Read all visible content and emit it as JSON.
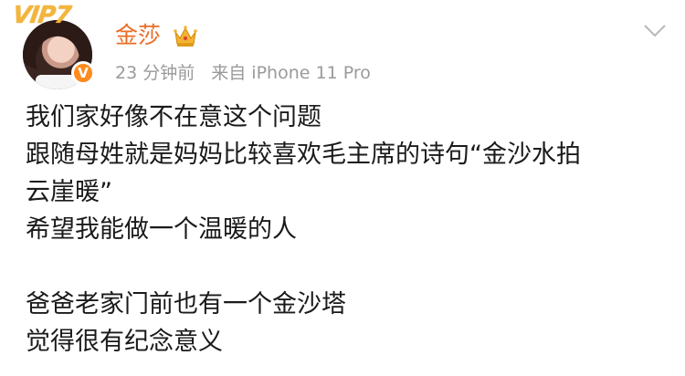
{
  "badge": {
    "vip_text": "VIP7"
  },
  "user": {
    "name": "金莎",
    "verified_symbol": "V"
  },
  "meta": {
    "time": "23 分钟前",
    "source": "来自 iPhone 11 Pro"
  },
  "post": {
    "lines": [
      "我们家好像不在意这个问题",
      "跟随母姓就是妈妈比较喜欢毛主席的诗句“金沙水拍",
      "云崖暖”",
      "希望我能做一个温暖的人",
      "",
      "爸爸老家门前也有一个金沙塔",
      "觉得很有纪念意义"
    ]
  },
  "colors": {
    "username": "#ea6d26",
    "meta": "#9a9a9a",
    "text": "#1a1a1a",
    "vip": "#f3b53a",
    "verified": "#ff8a1e"
  },
  "icons": [
    "crown-icon",
    "chevron-down-icon",
    "verified-icon"
  ]
}
